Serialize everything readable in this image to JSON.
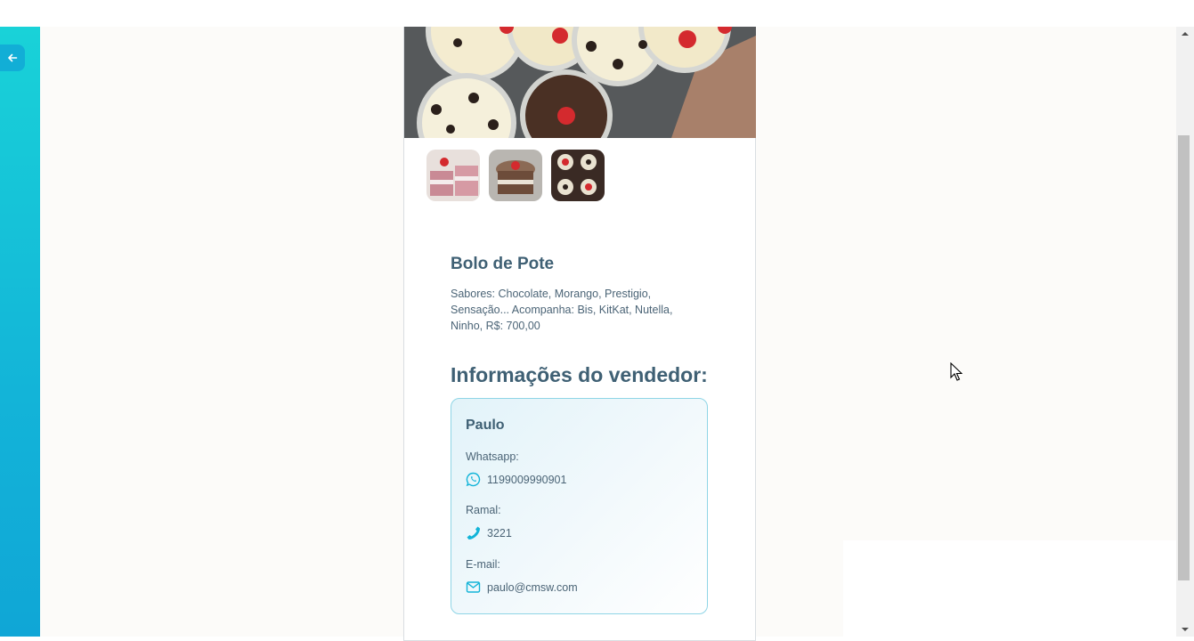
{
  "navigation": {
    "back_icon": "arrow-left-icon"
  },
  "product": {
    "title": "Bolo de Pote",
    "description": "Sabores: Chocolate, Morango, Prestigio, Sensação... Acompanha: Bis, KitKat, Nutella, Ninho, R$: 700,00",
    "thumbnail_count": 3
  },
  "seller_section": {
    "heading": "Informações do vendedor:",
    "name": "Paulo",
    "whatsapp_label": "Whatsapp:",
    "whatsapp_value": "1199009990901",
    "whatsapp_icon": "whatsapp-icon",
    "ramal_label": "Ramal:",
    "ramal_value": "3221",
    "ramal_icon": "phone-icon",
    "email_label": "E-mail:",
    "email_value": "paulo@cmsw.com",
    "email_icon": "mail-icon"
  },
  "colors": {
    "accent": "#13b4d8",
    "heading": "#3f6074",
    "text": "#4b6476"
  }
}
